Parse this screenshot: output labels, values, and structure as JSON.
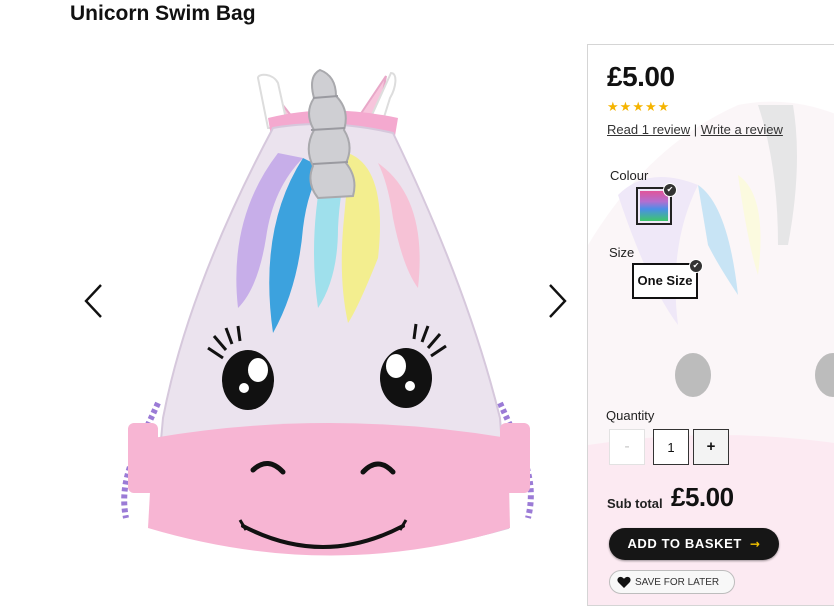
{
  "product": {
    "title": "Unicorn Swim Bag"
  },
  "carousel": {
    "prev_icon": "chevron-left-icon",
    "next_icon": "chevron-right-icon"
  },
  "purchase": {
    "price": "£5.00",
    "rating_stars": 5,
    "rating_max": 5,
    "read_reviews": "Read 1 review",
    "separator": "|",
    "write_review": "Write a review",
    "colour_label": "Colour",
    "size_label": "Size",
    "size_value": "One Size",
    "quantity_label": "Quantity",
    "quantity_minus": "-",
    "quantity_value": "1",
    "quantity_plus": "+",
    "subtotal_label": "Sub total",
    "subtotal_value": "£5.00",
    "add_to_basket": "ADD TO BASKET",
    "add_to_basket_arrow": "→",
    "save_for_later": "SAVE FOR LATER"
  },
  "colors": {
    "star": "#f5b400",
    "basket_button": "#161616",
    "basket_arrow": "#f5c400"
  }
}
